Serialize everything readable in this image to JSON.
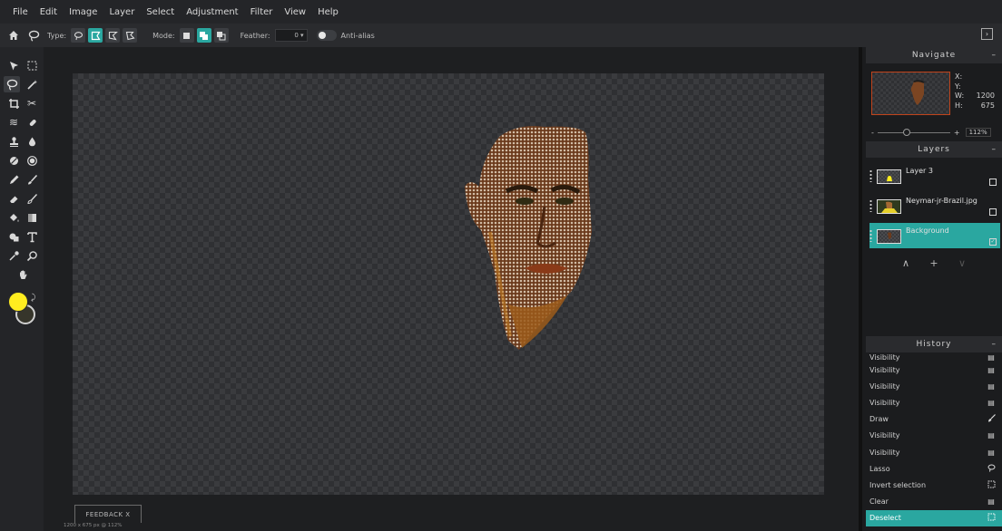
{
  "menu": [
    "File",
    "Edit",
    "Image",
    "Layer",
    "Select",
    "Adjustment",
    "Filter",
    "View",
    "Help"
  ],
  "options": {
    "type_label": "Type:",
    "mode_label": "Mode:",
    "feather_label": "Feather:",
    "feather_value": "0 ▾",
    "antialias_label": "Anti-alias"
  },
  "workspace": {
    "feedback_label": "FEEDBACK   X",
    "status": "1200 x 675 px @ 112%"
  },
  "navigate": {
    "title": "Navigate",
    "collapse": "–",
    "x_label": "X:",
    "x_value": "",
    "y_label": "Y:",
    "y_value": "",
    "w_label": "W:",
    "w_value": "1200",
    "h_label": "H:",
    "h_value": "675",
    "zoom_minus": "-",
    "zoom_plus": "+",
    "zoom_value": "112%"
  },
  "layers": {
    "title": "Layers",
    "collapse": "–",
    "items": [
      {
        "name": "Layer 3"
      },
      {
        "name": "Neymar-jr-Brazil.jpg"
      },
      {
        "name": "Background"
      }
    ],
    "controls": {
      "up": "∧",
      "add": "+",
      "down": "∨"
    }
  },
  "history": {
    "title": "History",
    "collapse": "–",
    "items": [
      {
        "label": "Visibility",
        "icon": "document-icon"
      },
      {
        "label": "Visibility",
        "icon": "document-icon"
      },
      {
        "label": "Visibility",
        "icon": "document-icon"
      },
      {
        "label": "Visibility",
        "icon": "document-icon"
      },
      {
        "label": "Draw",
        "icon": "brush-icon"
      },
      {
        "label": "Visibility",
        "icon": "document-icon"
      },
      {
        "label": "Visibility",
        "icon": "document-icon"
      },
      {
        "label": "Lasso",
        "icon": "lasso-icon"
      },
      {
        "label": "Invert selection",
        "icon": "marquee-icon"
      },
      {
        "label": "Clear",
        "icon": "document-icon"
      },
      {
        "label": "Deselect",
        "icon": "marquee-icon"
      }
    ]
  },
  "colors": {
    "accent": "#2aa7a0",
    "foreground": "#ffed1f",
    "background": "#36352b",
    "navigator_border": "#c0441c"
  }
}
